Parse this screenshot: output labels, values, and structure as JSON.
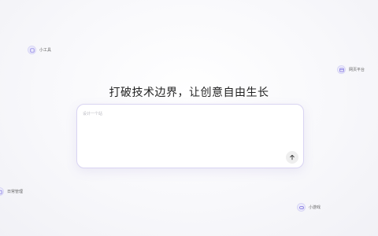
{
  "headline": "打破技术边界，让创意自由生长",
  "composer": {
    "placeholder": "设计一个站",
    "value": ""
  },
  "send_button": {
    "icon": "arrow-up-icon"
  },
  "floating_tags": [
    {
      "label": "小工具",
      "icon": "tool-icon"
    },
    {
      "label": "网页平台",
      "icon": "browser-icon"
    },
    {
      "label": "日常管理",
      "icon": "calendar-icon"
    },
    {
      "label": "小游戏",
      "icon": "gamepad-icon"
    }
  ],
  "colors": {
    "accent": "#7b6fe0",
    "icon_bg": "#ecebfb",
    "border": "#d9d4f2"
  }
}
